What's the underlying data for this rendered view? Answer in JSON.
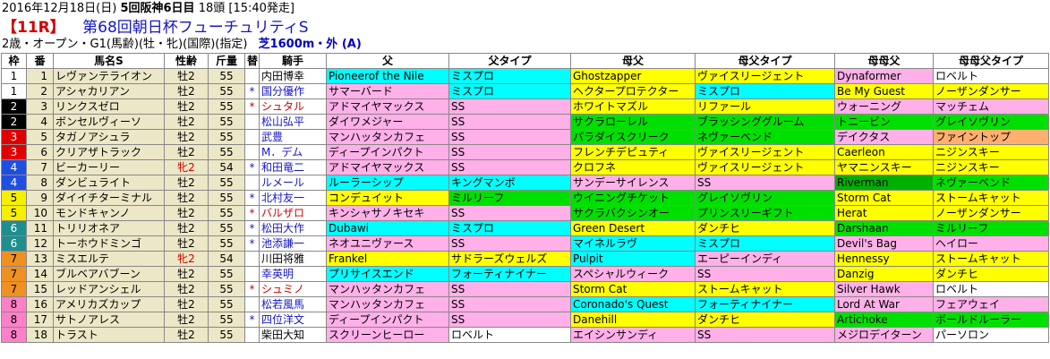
{
  "header": {
    "date_prefix": "2016年12月18日(日)",
    "meeting": "5回阪神6日目",
    "count": "18頭",
    "post_time": "[15:40発走]",
    "race_no": "【11R】",
    "race_name": "第68回朝日杯フューチュリティS",
    "conditions": "2歳・オープン・G1(馬齢)(牡・牝)(国際)(指定)",
    "surface": "芝1600m・外 (A)"
  },
  "columns": [
    "枠",
    "番",
    "馬名S",
    "性齢",
    "斤量",
    "替",
    "騎手",
    "父",
    "父タイプ",
    "母父",
    "母父タイプ",
    "母母父",
    "母母父タイプ"
  ],
  "colors": {
    "waku": [
      "#ffffff",
      "#000000",
      "#e00000",
      "#1f4fe0",
      "#f5ef00",
      "#1d8f8f",
      "#f09020",
      "#ff80c8"
    ],
    "waku_text": [
      "#000000",
      "#ffffff",
      "#ffffff",
      "#ffffff",
      "#000000",
      "#ffffff",
      "#000000",
      "#000000"
    ],
    "types": {
      "cyan": "#00ffff",
      "pink": "#ffb0e8",
      "yellow": "#ffff00",
      "green": "#00e000",
      "salmon": "#ffb070",
      "white": "#ffffff",
      "darkgreen": "#00b000"
    }
  },
  "rows": [
    {
      "waku": "1",
      "w": 0,
      "num": "1",
      "name": "レヴァンテライオン",
      "sex": "牡2",
      "weight": "55",
      "change": "",
      "jockey": "内田博幸",
      "jred": false,
      "jblue": false,
      "sire": "Pioneerof the Nile",
      "sire_bg": "cyan",
      "stype": "ミスプロ",
      "stype_bg": "cyan",
      "dsire": "Ghostzapper",
      "dsire_bg": "yellow",
      "dstype": "ヴァイスリージェント",
      "dstype_bg": "yellow",
      "gdsire": "Dynaformer",
      "gdsire_bg": "pink",
      "gdstype": "ロベルト",
      "gdstype_bg": "white"
    },
    {
      "waku": "1",
      "w": 0,
      "num": "2",
      "name": "アシャカリアン",
      "sex": "牡2",
      "weight": "55",
      "change": "*",
      "jockey": "国分優作",
      "jred": false,
      "jblue": true,
      "sire": "サマーバード",
      "sire_bg": "pink",
      "stype": "ミスプロ",
      "stype_bg": "cyan",
      "dsire": "ヘクタープロテクター",
      "dsire_bg": "yellow",
      "dstype": "ミスプロ",
      "dstype_bg": "cyan",
      "gdsire": "Be My Guest",
      "gdsire_bg": "yellow",
      "gdstype": "ノーザンダンサー",
      "gdstype_bg": "yellow"
    },
    {
      "waku": "2",
      "w": 1,
      "num": "3",
      "name": "リンクスゼロ",
      "sex": "牡2",
      "weight": "55",
      "change": "*",
      "jockey": "シュタル",
      "jred": true,
      "jblue": false,
      "sire": "アドマイヤマックス",
      "sire_bg": "pink",
      "stype": "SS",
      "stype_bg": "pink",
      "dsire": "ホワイトマズル",
      "dsire_bg": "yellow",
      "dstype": "リファール",
      "dstype_bg": "yellow",
      "gdsire": "ウォーニング",
      "gdsire_bg": "pink",
      "gdstype": "マッチェム",
      "gdstype_bg": "pink"
    },
    {
      "waku": "2",
      "w": 1,
      "num": "4",
      "name": "ボンセルヴィーソ",
      "sex": "牡2",
      "weight": "55",
      "change": "",
      "jockey": "松山弘平",
      "jred": false,
      "jblue": true,
      "sire": "ダイワメジャー",
      "sire_bg": "pink",
      "stype": "SS",
      "stype_bg": "pink",
      "dsire": "サクラローレル",
      "dsire_bg": "green",
      "dstype": "ブラッシンググルーム",
      "dstype_bg": "green",
      "gdsire": "トニービン",
      "gdsire_bg": "green",
      "gdstype": "グレイソヴリン",
      "gdstype_bg": "green"
    },
    {
      "waku": "3",
      "w": 2,
      "num": "5",
      "name": "タガノアシュラ",
      "sex": "牡2",
      "weight": "55",
      "change": "",
      "jockey": "武豊",
      "jred": false,
      "jblue": true,
      "sire": "マンハッタンカフェ",
      "sire_bg": "pink",
      "stype": "SS",
      "stype_bg": "pink",
      "dsire": "パラダイスクリーク",
      "dsire_bg": "green",
      "dstype": "ネヴァーベンド",
      "dstype_bg": "green",
      "gdsire": "デイクタス",
      "gdsire_bg": "pink",
      "gdstype": "ファイントップ",
      "gdstype_bg": "salmon"
    },
    {
      "waku": "3",
      "w": 2,
      "num": "6",
      "name": "クリアザトラック",
      "sex": "牡2",
      "weight": "55",
      "change": "",
      "jockey": "M．デム",
      "jred": false,
      "jblue": true,
      "sire": "ディープインパクト",
      "sire_bg": "pink",
      "stype": "SS",
      "stype_bg": "pink",
      "dsire": "フレンチデピュティ",
      "dsire_bg": "yellow",
      "dstype": "ヴァイスリージェント",
      "dstype_bg": "yellow",
      "gdsire": "Caerleon",
      "gdsire_bg": "yellow",
      "gdstype": "ニジンスキー",
      "gdstype_bg": "yellow"
    },
    {
      "waku": "4",
      "w": 3,
      "num": "7",
      "name": "ビーカーリー",
      "sex": "牝2",
      "weight": "54",
      "change": "*",
      "jockey": "和田竜二",
      "jred": false,
      "jblue": true,
      "sire": "アドマイヤマックス",
      "sire_bg": "pink",
      "stype": "SS",
      "stype_bg": "pink",
      "dsire": "クロフネ",
      "dsire_bg": "yellow",
      "dstype": "ヴァイスリージェント",
      "dstype_bg": "yellow",
      "gdsire": "ヤマニンスキー",
      "gdsire_bg": "yellow",
      "gdstype": "ニジンスキー",
      "gdstype_bg": "yellow"
    },
    {
      "waku": "4",
      "w": 3,
      "num": "8",
      "name": "ダンビュライト",
      "sex": "牡2",
      "weight": "55",
      "change": "",
      "jockey": "ルメール",
      "jred": false,
      "jblue": true,
      "sire": "ルーラーシップ",
      "sire_bg": "cyan",
      "stype": "キングマンボ",
      "stype_bg": "cyan",
      "dsire": "サンデーサイレンス",
      "dsire_bg": "pink",
      "dstype": "SS",
      "dstype_bg": "pink",
      "gdsire": "Riverman",
      "gdsire_bg": "darkgreen",
      "gdstype": "ネヴァーベンド",
      "gdstype_bg": "green"
    },
    {
      "waku": "5",
      "w": 4,
      "num": "9",
      "name": "ダイイチターミナル",
      "sex": "牡2",
      "weight": "55",
      "change": "*",
      "jockey": "北村友一",
      "jred": false,
      "jblue": true,
      "sire": "コンデュイット",
      "sire_bg": "yellow",
      "stype": "ミルリーフ",
      "stype_bg": "green",
      "dsire": "ウイニングチケット",
      "dsire_bg": "green",
      "dstype": "グレイソヴリン",
      "dstype_bg": "green",
      "gdsire": "Storm Cat",
      "gdsire_bg": "yellow",
      "gdstype": "ストームキャット",
      "gdstype_bg": "yellow"
    },
    {
      "waku": "5",
      "w": 4,
      "num": "10",
      "name": "モンドキャンノ",
      "sex": "牡2",
      "weight": "55",
      "change": "*",
      "jockey": "バルザロ",
      "jred": true,
      "jblue": false,
      "sire": "キンシャサノキセキ",
      "sire_bg": "pink",
      "stype": "SS",
      "stype_bg": "pink",
      "dsire": "サクラバクシンオー",
      "dsire_bg": "green",
      "dstype": "プリンスリーギフト",
      "dstype_bg": "green",
      "gdsire": "Herat",
      "gdsire_bg": "yellow",
      "gdstype": "ノーザンダンサー",
      "gdstype_bg": "yellow"
    },
    {
      "waku": "6",
      "w": 5,
      "num": "11",
      "name": "トリリオネア",
      "sex": "牡2",
      "weight": "55",
      "change": "*",
      "jockey": "松田大作",
      "jred": false,
      "jblue": true,
      "sire": "Dubawi",
      "sire_bg": "cyan",
      "stype": "ミスプロ",
      "stype_bg": "cyan",
      "dsire": "Green Desert",
      "dsire_bg": "yellow",
      "dstype": "ダンチヒ",
      "dstype_bg": "yellow",
      "gdsire": "Darshaan",
      "gdsire_bg": "green",
      "gdstype": "ミルリーフ",
      "gdstype_bg": "green"
    },
    {
      "waku": "6",
      "w": 5,
      "num": "12",
      "name": "トーホウドミンゴ",
      "sex": "牡2",
      "weight": "55",
      "change": "*",
      "jockey": "池添謙一",
      "jred": false,
      "jblue": true,
      "sire": "ネオユニヴァース",
      "sire_bg": "pink",
      "stype": "SS",
      "stype_bg": "pink",
      "dsire": "マイネルラヴ",
      "dsire_bg": "cyan",
      "dstype": "ミスプロ",
      "dstype_bg": "cyan",
      "gdsire": "Devil's Bag",
      "gdsire_bg": "pink",
      "gdstype": "ヘイロー",
      "gdstype_bg": "pink"
    },
    {
      "waku": "7",
      "w": 6,
      "num": "13",
      "name": "ミスエルテ",
      "sex": "牝2",
      "weight": "54",
      "change": "",
      "jockey": "川田将雅",
      "jred": false,
      "jblue": false,
      "sire": "Frankel",
      "sire_bg": "yellow",
      "stype": "サドラーズウェルズ",
      "stype_bg": "yellow",
      "dsire": "Pulpit",
      "dsire_bg": "cyan",
      "dstype": "エーピーインディ",
      "dstype_bg": "pink",
      "gdsire": "Hennessy",
      "gdsire_bg": "yellow",
      "gdstype": "ストームキャット",
      "gdstype_bg": "yellow"
    },
    {
      "waku": "7",
      "w": 6,
      "num": "14",
      "name": "ブルベアバブーン",
      "sex": "牡2",
      "weight": "55",
      "change": "",
      "jockey": "幸英明",
      "jred": false,
      "jblue": true,
      "sire": "プリサイスエンド",
      "sire_bg": "cyan",
      "stype": "フォーティナイナー",
      "stype_bg": "cyan",
      "dsire": "スペシャルウィーク",
      "dsire_bg": "pink",
      "dstype": "SS",
      "dstype_bg": "pink",
      "gdsire": "Danzig",
      "gdsire_bg": "yellow",
      "gdstype": "ダンチヒ",
      "gdstype_bg": "yellow"
    },
    {
      "waku": "7",
      "w": 6,
      "num": "15",
      "name": "レッドアンシェル",
      "sex": "牡2",
      "weight": "55",
      "change": "*",
      "jockey": "シュミノ",
      "jred": true,
      "jblue": false,
      "sire": "マンハッタンカフェ",
      "sire_bg": "pink",
      "stype": "SS",
      "stype_bg": "pink",
      "dsire": "Storm Cat",
      "dsire_bg": "yellow",
      "dstype": "ストームキャット",
      "dstype_bg": "yellow",
      "gdsire": "Silver Hawk",
      "gdsire_bg": "pink",
      "gdstype": "ロベルト",
      "gdstype_bg": "white"
    },
    {
      "waku": "8",
      "w": 7,
      "num": "16",
      "name": "アメリカズカップ",
      "sex": "牡2",
      "weight": "55",
      "change": "",
      "jockey": "松若風馬",
      "jred": false,
      "jblue": true,
      "sire": "マンハッタンカフェ",
      "sire_bg": "pink",
      "stype": "SS",
      "stype_bg": "pink",
      "dsire": "Coronado's Quest",
      "dsire_bg": "cyan",
      "dstype": "フォーティナイナー",
      "dstype_bg": "cyan",
      "gdsire": "Lord At War",
      "gdsire_bg": "pink",
      "gdstype": "フェアウェイ",
      "gdstype_bg": "pink"
    },
    {
      "waku": "8",
      "w": 7,
      "num": "17",
      "name": "サトノアレス",
      "sex": "牡2",
      "weight": "55",
      "change": "*",
      "jockey": "四位洋文",
      "jred": false,
      "jblue": true,
      "sire": "ディープインパクト",
      "sire_bg": "pink",
      "stype": "SS",
      "stype_bg": "pink",
      "dsire": "Danehill",
      "dsire_bg": "yellow",
      "dstype": "ダンチヒ",
      "dstype_bg": "yellow",
      "gdsire": "Artichoke",
      "gdsire_bg": "green",
      "gdstype": "ボールドルーラー",
      "gdstype_bg": "green"
    },
    {
      "waku": "8",
      "w": 7,
      "num": "18",
      "name": "トラスト",
      "sex": "牡2",
      "weight": "55",
      "change": "",
      "jockey": "柴田大知",
      "jred": false,
      "jblue": false,
      "sire": "スクリーンヒーロー",
      "sire_bg": "pink",
      "stype": "ロベルト",
      "stype_bg": "white",
      "dsire": "エイシンサンディ",
      "dsire_bg": "pink",
      "dstype": "SS",
      "dstype_bg": "pink",
      "gdsire": "メジロデイターン",
      "gdsire_bg": "pink",
      "gdstype": "パーソロン",
      "gdstype_bg": "white"
    }
  ]
}
